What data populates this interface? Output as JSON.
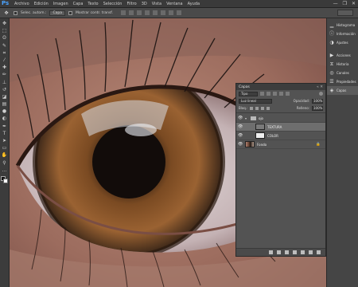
{
  "app": {
    "logo": "Ps"
  },
  "menu": {
    "items": [
      "Archivo",
      "Edición",
      "Imagen",
      "Capa",
      "Texto",
      "Selección",
      "Filtro",
      "3D",
      "Vista",
      "Ventana",
      "Ayuda"
    ]
  },
  "window_controls": {
    "minimize": "—",
    "restore": "❐",
    "close": "✕"
  },
  "options_bar": {
    "tool_icon": "move-tool-icon",
    "auto_select_label": "Selec. autom.:",
    "auto_select_value": "Capa",
    "show_transform_label": "Mostrar contr. transf."
  },
  "tools": [
    {
      "name": "move-tool-icon",
      "glyph": "✥"
    },
    {
      "name": "marquee-tool-icon",
      "glyph": "⬚"
    },
    {
      "name": "lasso-tool-icon",
      "glyph": "ʘ"
    },
    {
      "name": "quick-select-tool-icon",
      "glyph": "✎"
    },
    {
      "name": "crop-tool-icon",
      "glyph": "⌗"
    },
    {
      "name": "eyedropper-tool-icon",
      "glyph": "⁄"
    },
    {
      "name": "healing-tool-icon",
      "glyph": "✚"
    },
    {
      "name": "brush-tool-icon",
      "glyph": "✏"
    },
    {
      "name": "stamp-tool-icon",
      "glyph": "⊥"
    },
    {
      "name": "history-brush-tool-icon",
      "glyph": "↺"
    },
    {
      "name": "eraser-tool-icon",
      "glyph": "◪"
    },
    {
      "name": "gradient-tool-icon",
      "glyph": "▤"
    },
    {
      "name": "blur-tool-icon",
      "glyph": "●"
    },
    {
      "name": "dodge-tool-icon",
      "glyph": "◐"
    },
    {
      "name": "pen-tool-icon",
      "glyph": "✒"
    },
    {
      "name": "type-tool-icon",
      "glyph": "T"
    },
    {
      "name": "path-select-tool-icon",
      "glyph": "➤"
    },
    {
      "name": "shape-tool-icon",
      "glyph": "▭"
    },
    {
      "name": "hand-tool-icon",
      "glyph": "✋"
    },
    {
      "name": "zoom-tool-icon",
      "glyph": "⚲"
    },
    {
      "name": "more-tools-icon",
      "glyph": "…"
    }
  ],
  "dock": {
    "group1": [
      {
        "icon": "histogram-icon",
        "glyph": "▁",
        "label": "Histograma"
      },
      {
        "icon": "info-icon",
        "glyph": "ⓘ",
        "label": "Información"
      },
      {
        "icon": "adjustments-icon",
        "glyph": "◑",
        "label": "Ajustes"
      }
    ],
    "group2": [
      {
        "icon": "actions-icon",
        "glyph": "▶",
        "label": "Acciones"
      },
      {
        "icon": "history-icon",
        "glyph": "⧖",
        "label": "Historia"
      },
      {
        "icon": "channels-icon",
        "glyph": "◎",
        "label": "Canales"
      },
      {
        "icon": "properties-icon",
        "glyph": "☰",
        "label": "Propiedades"
      },
      {
        "icon": "layers-icon",
        "glyph": "◈",
        "label": "Capas"
      }
    ]
  },
  "layers_panel": {
    "title": "Capas",
    "filter_kind": "Tipo",
    "blend_mode": "Luz lineal",
    "opacity_label": "Opacidad:",
    "opacity_value": "100%",
    "lock_label": "Bloq.:",
    "fill_label": "Relleno:",
    "fill_value": "100%",
    "layers": [
      {
        "name": "ojo",
        "type": "group"
      },
      {
        "name": "TEXTURA",
        "type": "layer",
        "selected": true
      },
      {
        "name": "COLOR",
        "type": "layer"
      },
      {
        "name": "Fondo",
        "type": "background",
        "locked": true
      }
    ]
  }
}
